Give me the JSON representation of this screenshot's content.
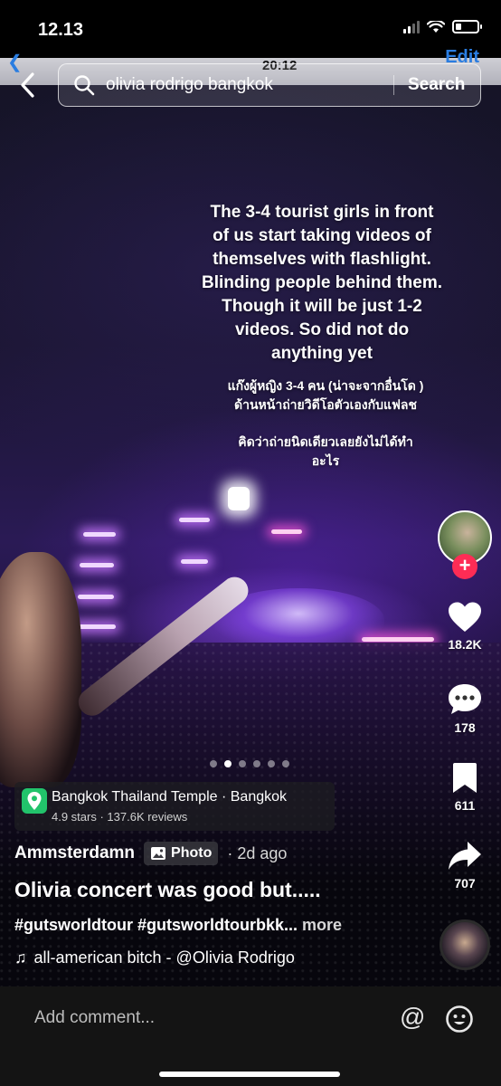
{
  "status_bar": {
    "time": "12.13",
    "battery_level": 0.25
  },
  "underlay": {
    "time": "20:12",
    "edit_label": "Edit"
  },
  "search": {
    "query": "olivia rodrigo bangkok",
    "button_label": "Search"
  },
  "caption": {
    "english": "The 3-4 tourist girls in front of us start taking videos of themselves with flashlight. Blinding people behind them. Though it will be just 1-2 videos. So did not do anything yet",
    "thai_1": "แก๊งผู้หญิง 3-4 คน (น่าจะจากอื่นโด ) ด้านหน้าถ่ายวิดีโอตัวเองกับแฟลช",
    "thai_2": "คิดว่าถ่ายนิดเดียวเลยยังไม่ได้ทำอะไร"
  },
  "actions": {
    "likes": "18.2K",
    "comments": "178",
    "bookmarks": "611",
    "shares": "707",
    "follow_symbol": "+"
  },
  "carousel": {
    "total": 6,
    "active_index": 1
  },
  "location": {
    "name": "Bangkok Thailand Temple · Bangkok",
    "details": "4.9 stars · 137.6K reviews"
  },
  "post": {
    "author": "Ammsterdamn",
    "badge": "Photo",
    "time_ago": "· 2d ago",
    "title": "Olivia concert was good but.....",
    "hashtags": "#gutsworldtour #gutsworldtourbkk...",
    "more_label": " more",
    "sound": "all-american bitch - @Olivia Rodrigo",
    "sound_icon": "♫"
  },
  "comment_bar": {
    "placeholder": "Add comment...",
    "at_symbol": "@"
  },
  "colors": {
    "accent_red": "#fe2c55",
    "location_green": "#22c36b",
    "link_blue": "#2a7de1"
  }
}
